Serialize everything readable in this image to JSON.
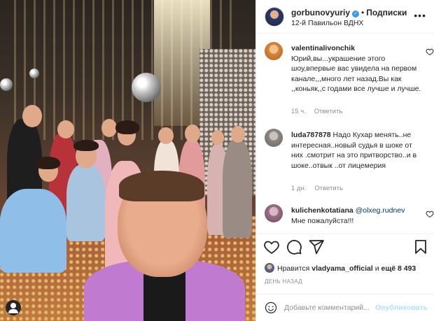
{
  "post": {
    "username": "gorbunovyuriy",
    "follow_label": "Подписки",
    "location": "12-й Павильон ВДНХ",
    "more_icon": "more-horizontal-icon"
  },
  "comments": [
    {
      "username": "valentinalivonchik",
      "text": "Юрий,вы...украшение этого шоу,впервые вас увидела на первом канале,,,много лет назад.Вы как ,,коньяк,,с годами все лучше и лучше.",
      "time": "15 ч.",
      "reply": "Ответить"
    },
    {
      "username": "luda787878",
      "text": "Надо Кухар менять..не интересная..новый судья в шоке от них .смотрит на это притворство..и в шоке..отвык ..от лицемерия",
      "time": "1 дн.",
      "reply": "Ответить"
    },
    {
      "username": "kulichenkotatiana",
      "mention": "@olxeg.rudnev",
      "text": "Мне пожалуйста!!!"
    }
  ],
  "likes": {
    "prefix": "Нравится",
    "user": "vladyama_official",
    "middle": "и",
    "count": "ещё 8 493"
  },
  "date": "ДЕНЬ НАЗАД",
  "add_comment": {
    "placeholder": "Добавьте комментарий...",
    "publish_label": "Опубликовать"
  },
  "colors": {
    "link": "#00376b",
    "publish_disabled": "#b2dffc",
    "verified": "#3897f0",
    "secondary_text": "#8e8e8e"
  }
}
